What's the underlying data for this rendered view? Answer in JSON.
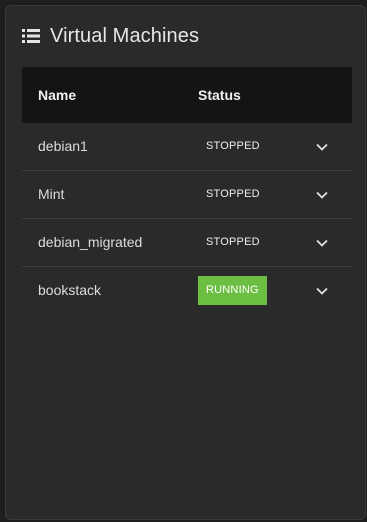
{
  "panel": {
    "title": "Virtual Machines",
    "header_icon": "list-icon"
  },
  "table": {
    "columns": [
      "Name",
      "Status"
    ],
    "rows": [
      {
        "name": "debian1",
        "status": "STOPPED",
        "status_color": "#2a2a2a",
        "expand_icon": "chevron-down-icon"
      },
      {
        "name": "Mint",
        "status": "STOPPED",
        "status_color": "#2a2a2a",
        "expand_icon": "chevron-down-icon"
      },
      {
        "name": "debian_migrated",
        "status": "STOPPED",
        "status_color": "#2a2a2a",
        "expand_icon": "chevron-down-icon"
      },
      {
        "name": "bookstack",
        "status": "RUNNING",
        "status_color": "#6cbf43",
        "expand_icon": "chevron-down-icon"
      }
    ]
  },
  "colors": {
    "panel_background": "#2a2a2a",
    "header_background": "#141414",
    "running": "#6cbf43"
  }
}
